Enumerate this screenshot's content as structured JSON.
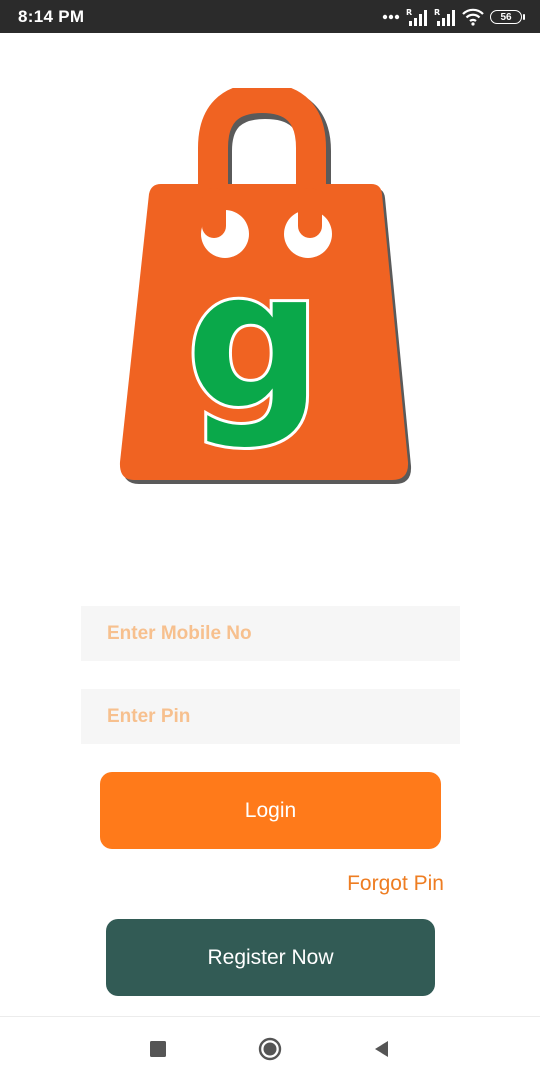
{
  "status_bar": {
    "time": "8:14 PM",
    "battery_level": "56",
    "icons": [
      "more-dots-icon",
      "signal-r-icon",
      "signal-r-icon",
      "wifi-icon",
      "battery-icon"
    ]
  },
  "logo": {
    "icon": "shopping-bag-logo-icon",
    "letter": "g",
    "colors": {
      "bag": "#f06322",
      "bag_shadow": "#5a5a5a",
      "letter": "#0aa84a"
    }
  },
  "login_form": {
    "mobile_placeholder": "Enter Mobile No",
    "mobile_value": "",
    "pin_placeholder": "Enter Pin",
    "pin_value": "",
    "login_label": "Login",
    "forgot_label": "Forgot Pin",
    "register_label": "Register Now"
  },
  "colors": {
    "accent": "#ff7a1a",
    "secondary": "#325b55",
    "placeholder": "#f7c08e",
    "link": "#ee7d22"
  },
  "nav_bar": {
    "icons": [
      "recent-apps-icon",
      "home-icon",
      "back-icon"
    ]
  }
}
